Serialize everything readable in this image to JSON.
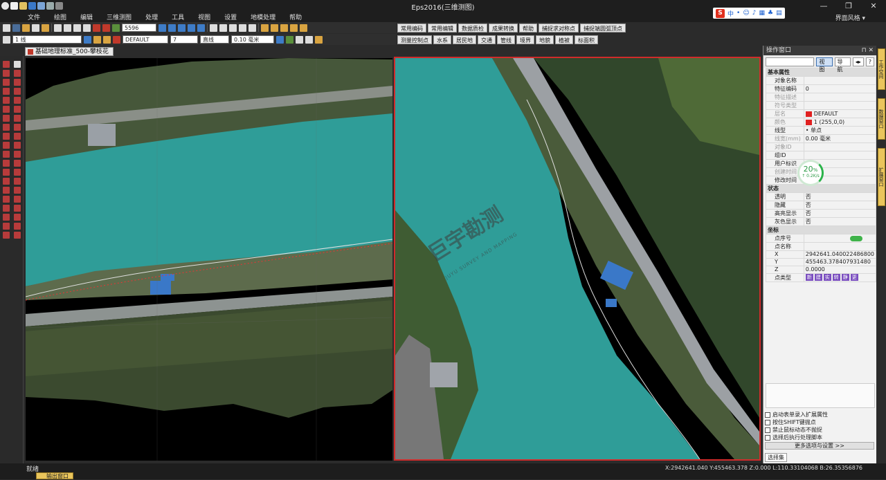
{
  "window": {
    "title": "Eps2016(三维测图)",
    "minimize": "—",
    "maximize": "❐",
    "close": "✕"
  },
  "menu": [
    "文件",
    "绘图",
    "编辑",
    "三维测图",
    "处理",
    "工具",
    "视图",
    "设置",
    "地模处理",
    "帮助"
  ],
  "skin_label": "界面风格 ▾",
  "ime": {
    "logo": "S",
    "lang": "中"
  },
  "toolbar1": {
    "scale_value": "5596"
  },
  "toolbar2": {
    "line_type": "1 线",
    "layer": "DEFAULT",
    "color_value": "7",
    "line_style": "直线",
    "line_width": "0.10 毫米"
  },
  "right_toolbar1": [
    "常用编码",
    "常用编辑",
    "数据质检",
    "成果转换",
    "帮助",
    "捕捉求对称点",
    "捕捉端圆弧顶点"
  ],
  "right_toolbar2": [
    "测量控制点",
    "水系",
    "居民地",
    "交通",
    "管线",
    "境界",
    "地貌",
    "植被",
    "标面积"
  ],
  "document_tab": "基础地理标准_500-攀枝花",
  "watermark": {
    "main": "巨宇勘测",
    "sub": "JUYU SURVEY AND MAPPING"
  },
  "panel": {
    "title": "操作窗口",
    "tab_view": "视图",
    "tab_nav": "导航",
    "help": "?",
    "groups": [
      {
        "name": "基本属性",
        "rows": [
          {
            "k": "对象名称",
            "v": ""
          },
          {
            "k": "特征编码",
            "v": "0",
            "dim": false
          },
          {
            "k": "特征描述",
            "v": "",
            "dim": true
          },
          {
            "k": "符号类型",
            "v": "",
            "dim": true
          },
          {
            "k": "层名",
            "v": "DEFAULT",
            "swatch": true,
            "dim": true
          },
          {
            "k": "颜色",
            "v": "1 (255,0,0)",
            "swatch": true,
            "dim": true
          },
          {
            "k": "线型",
            "v": "• 单点"
          },
          {
            "k": "线宽(mm)",
            "v": "0.00 毫米",
            "dim": true
          },
          {
            "k": "对象ID",
            "v": "",
            "dim": true
          },
          {
            "k": "组ID",
            "v": ""
          },
          {
            "k": "用户标识",
            "v": ""
          },
          {
            "k": "创建时间",
            "v": "",
            "dim": true
          },
          {
            "k": "修改时间",
            "v": ""
          }
        ]
      },
      {
        "name": "状态",
        "rows": [
          {
            "k": "透明",
            "v": "否"
          },
          {
            "k": "隐藏",
            "v": "否"
          },
          {
            "k": "高亮显示",
            "v": "否"
          },
          {
            "k": "灰色显示",
            "v": "否"
          }
        ]
      },
      {
        "name": "坐标",
        "rows": [
          {
            "k": "点序号",
            "v": ""
          },
          {
            "k": "点名称",
            "v": ""
          },
          {
            "k": "X",
            "v": "2942641.040022486800"
          },
          {
            "k": "Y",
            "v": "455463.378407931480"
          },
          {
            "k": "Z",
            "v": "0.0000"
          },
          {
            "k": "点类型",
            "v": ""
          }
        ]
      }
    ],
    "point_type_buttons": [
      "新",
      "建",
      "实",
      "转",
      "静",
      "更"
    ],
    "checkboxes": [
      "启动表单录入扩展属性",
      "按住SHIFT键抛点",
      "禁止鼠标动态不抛捉",
      "选择后执行处理脚本"
    ],
    "more_button": "更多选项与设置 >>",
    "select_tab": "选择集"
  },
  "dock_tabs": [
    "工作空间",
    "数据窗口",
    "扩展窗口"
  ],
  "speed_widget": {
    "percent": "20",
    "unit": "%",
    "rate": "↑ 0.2K/s"
  },
  "status": {
    "left": "就绪",
    "coords": "X:2942641.040 Y:455463.378 Z:0.000 L:110.33104068 B:26.35356876",
    "bottom_tab": "输出窗口"
  },
  "colors": {
    "selection_border": "#d12b2b",
    "water": "#2f9d98",
    "accent_ok": "#3fb34a"
  }
}
